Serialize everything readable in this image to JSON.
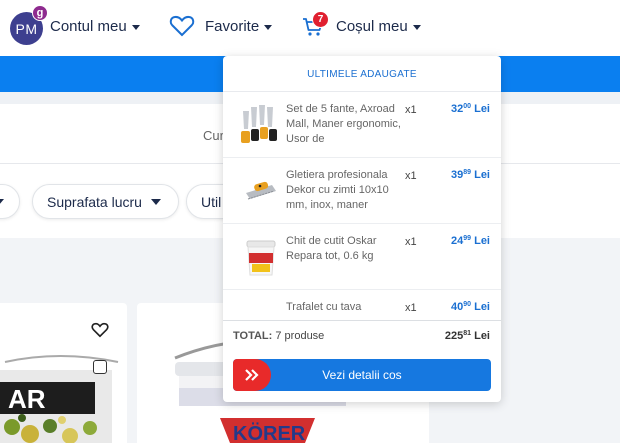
{
  "header": {
    "avatar_initials": "PM",
    "avatar_badge": "g",
    "account_label": "Contul meu",
    "favorites_label": "Favorite",
    "cart_label": "Coșul meu",
    "cart_count": "7"
  },
  "filters": {
    "partial_label": "Cur",
    "chips": [
      "",
      "Suprafata lucru",
      "Util"
    ]
  },
  "cart": {
    "title": "ULTIMELE ADAUGATE",
    "items": [
      {
        "name": "Set de 5 fante, Axroad Mall, Maner ergonomic, Usor de",
        "qty": "x1",
        "price_int": "32",
        "price_dec": "00",
        "currency": "Lei"
      },
      {
        "name": "Gletiera profesionala Dekor cu zimti 10x10 mm, inox, maner",
        "qty": "x1",
        "price_int": "39",
        "price_dec": "89",
        "currency": "Lei"
      },
      {
        "name": "Chit de cutit Oskar Repara tot, 0.6 kg",
        "qty": "x1",
        "price_int": "24",
        "price_dec": "99",
        "currency": "Lei"
      },
      {
        "name": "Trafalet cu tava",
        "qty": "x1",
        "price_int": "40",
        "price_dec": "90",
        "currency": "Lei"
      }
    ],
    "total_label": "TOTAL:",
    "total_count": "7 produse",
    "total_int": "225",
    "total_dec": "81",
    "total_currency": "Lei",
    "details_button": "Vezi detalii cos"
  },
  "products": {
    "brand1_partial": "AR",
    "brand2_partial": "KÖRER"
  },
  "colors": {
    "brand_blue": "#0a7ff0",
    "badge_red": "#e02030",
    "price_blue": "#1a6fd1"
  }
}
